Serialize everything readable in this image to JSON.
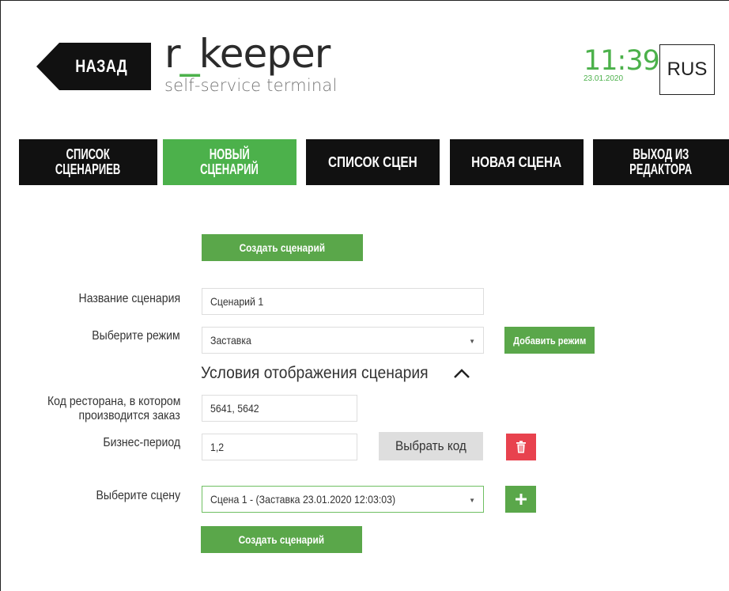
{
  "header": {
    "back_label": "НАЗАД",
    "logo_prefix": "r",
    "logo_underscore": "_",
    "logo_suffix": "keeper",
    "logo_subtitle": "self-service terminal",
    "time": "11:39",
    "date": "23.01.2020",
    "language": "RUS"
  },
  "tabs": [
    {
      "line1": "СПИСОК",
      "line2": "СЦЕНАРИЕВ",
      "active": false
    },
    {
      "line1": "НОВЫЙ",
      "line2": "СЦЕНАРИЙ",
      "active": true
    },
    {
      "line1": "СПИСОК СЦЕН",
      "line2": "",
      "active": false
    },
    {
      "line1": "НОВАЯ СЦЕНА",
      "line2": "",
      "active": false
    },
    {
      "line1": "ВЫХОД ИЗ",
      "line2": "РЕДАКТОРА",
      "active": false
    }
  ],
  "form": {
    "create_top_label": "Создать сценарий",
    "name_label": "Название сценария",
    "name_value": "Сценарий 1",
    "mode_label": "Выберите режим",
    "mode_value": "Заставка",
    "add_mode_label": "Добавить режим",
    "conditions_title": "Условия отображения сценария",
    "restaurant_label_1": "Код ресторана, в котором",
    "restaurant_label_2": "производится заказ",
    "restaurant_value": "5641, 5642",
    "business_label": "Бизнес-период",
    "business_value": "1,2",
    "choose_code_label": "Выбрать код",
    "scene_label": "Выберите сцену",
    "scene_value": "Сцена 1 - (Заставка 23.01.2020 12:03:03)",
    "create_bottom_label": "Создать сценарий"
  },
  "colors": {
    "accent_green": "#4cb14b",
    "button_green": "#5aa74a",
    "delete_red": "#e8424e",
    "tab_black": "#111111"
  }
}
